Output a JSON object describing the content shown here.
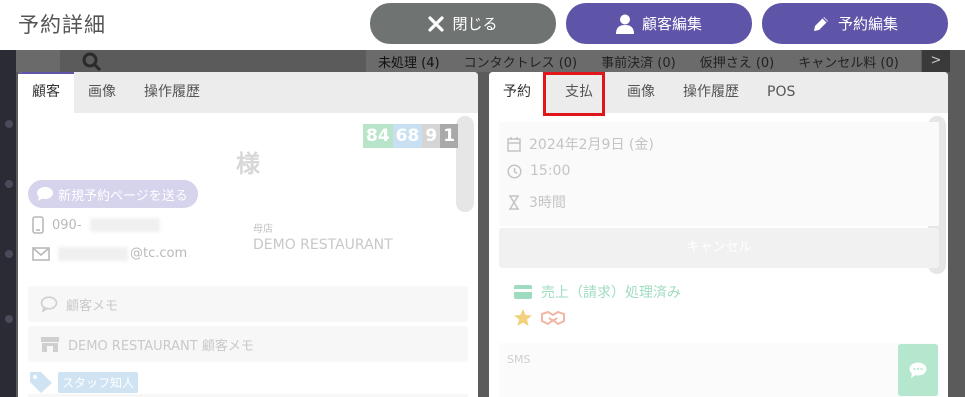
{
  "header": {
    "title": "予約詳細",
    "close_label": "閉じる",
    "customer_edit_label": "顧客編集",
    "reservation_edit_label": "予約編集"
  },
  "background": {
    "tabs": [
      {
        "label": "未処理 (4)"
      },
      {
        "label": "コンタクトレス (0)"
      },
      {
        "label": "事前決済 (0)"
      },
      {
        "label": "仮押さえ (0)"
      },
      {
        "label": "キャンセル料 (0)"
      }
    ],
    "next_label": ">"
  },
  "left_panel": {
    "tabs": [
      {
        "label": "顧客"
      },
      {
        "label": "画像"
      },
      {
        "label": "操作履歴"
      }
    ],
    "scores": [
      "84",
      "68",
      "9",
      "1"
    ],
    "honorific": "様",
    "send_page_label": "新規予約ページを送る",
    "phone_prefix": "090-",
    "email_suffix": "@tc.com",
    "store_label": "母店",
    "store_name": "DEMO RESTAURANT",
    "customer_memo_label": "顧客メモ",
    "store_memo_label": "DEMO RESTAURANT 顧客メモ",
    "staff_tag_label": "スタッフ知人"
  },
  "right_panel": {
    "tabs": [
      {
        "label": "予約"
      },
      {
        "label": "支払"
      },
      {
        "label": "画像"
      },
      {
        "label": "操作履歴"
      },
      {
        "label": "POS"
      }
    ],
    "date": "2024年2月9日 (金)",
    "time": "15:00",
    "duration": "3時間",
    "cancel_label": "キャンセル",
    "sales_status": "売上（請求）処理済み",
    "sms_label": "SMS"
  },
  "colors": {
    "primary": "#5f55a8",
    "close": "#6f7473",
    "highlight": "#e0161b",
    "score_colors": [
      "#b8e4c9",
      "#c8e0f2",
      "#d5d5d5",
      "#a9a9a9"
    ]
  }
}
